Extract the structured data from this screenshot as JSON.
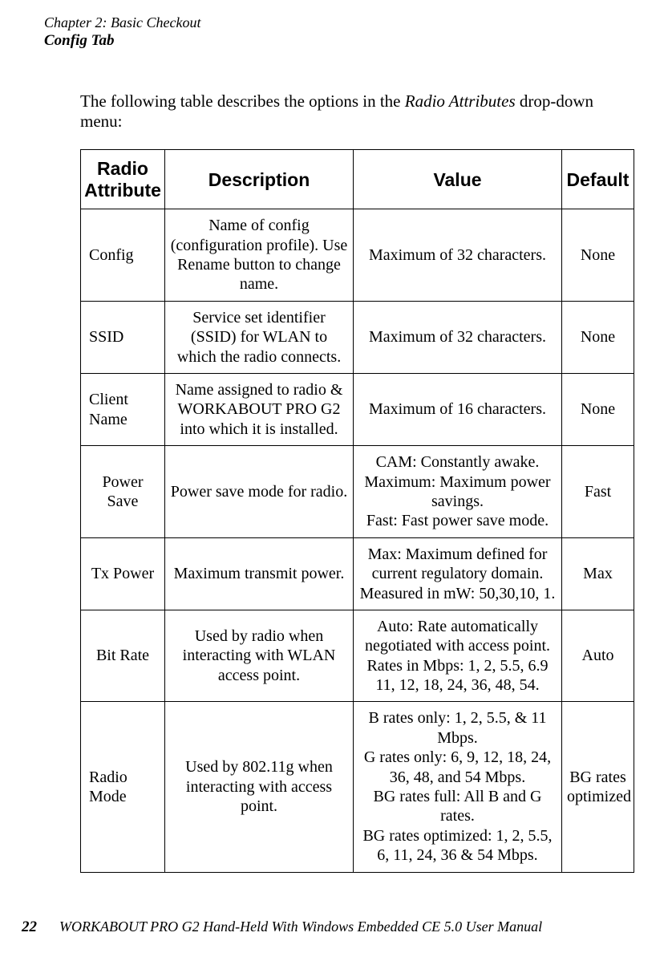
{
  "header": {
    "chapter": "Chapter  2:  Basic Checkout",
    "section": "Config Tab"
  },
  "intro": {
    "pre": "The following table describes the options in the ",
    "ital": "Radio Attributes",
    "post": " drop-down menu:"
  },
  "table": {
    "headers": {
      "attr_l1": "Radio",
      "attr_l2": "Attribute",
      "desc": "Description",
      "value": "Value",
      "default": "Default"
    },
    "rows": [
      {
        "attr": "Config",
        "desc": "Name of config (configuration profile). Use Rename button to change name.",
        "value": "Maximum of 32 characters.",
        "default": "None",
        "attr_align": "left"
      },
      {
        "attr": "SSID",
        "desc": "Service set identifier (SSID) for WLAN to which the radio connects.",
        "value": "Maximum of 32 characters.",
        "default": "None",
        "attr_align": "left"
      },
      {
        "attr": "Client Name",
        "desc": "Name assigned to radio & WORKABOUT PRO G2 into which it is installed.",
        "value": "Maximum of 16 characters.",
        "default": "None",
        "attr_align": "left"
      },
      {
        "attr": "Power Save",
        "desc": "Power save mode for radio.",
        "value": "CAM: Constantly awake.\nMaximum: Maximum power savings.\nFast: Fast power save mode.",
        "default": "Fast",
        "attr_align": "center"
      },
      {
        "attr": "Tx Power",
        "desc": "Maximum transmit power.",
        "value": "Max: Maximum defined for current regulatory domain. Measured in mW: 50,30,10, 1.",
        "default": "Max",
        "attr_align": "center"
      },
      {
        "attr": "Bit Rate",
        "desc": "Used by radio when interacting with WLAN access point.",
        "value": "Auto: Rate automatically negotiated with access point.\nRates in Mbps: 1, 2, 5.5, 6.9 11, 12, 18, 24, 36, 48, 54.",
        "default": "Auto",
        "attr_align": "center"
      },
      {
        "attr": "Radio Mode",
        "desc": "Used by 802.11g when interacting with access point.",
        "value": "B rates only: 1, 2, 5.5, & 11 Mbps.\nG rates only: 6, 9, 12, 18, 24, 36, 48, and 54 Mbps.\nBG rates full: All B and G rates.\nBG rates optimized: 1, 2, 5.5, 6, 11, 24, 36 & 54 Mbps.",
        "default": "BG rates optimized",
        "attr_align": "left"
      }
    ]
  },
  "footer": {
    "page": "22",
    "text": "WORKABOUT PRO G2 Hand-Held With Windows Embedded CE 5.0 User Manual"
  }
}
